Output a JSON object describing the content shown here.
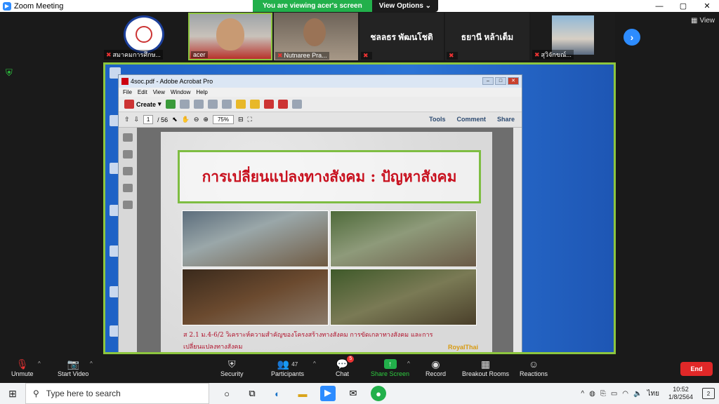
{
  "window": {
    "title": "Zoom Meeting",
    "controls": [
      "—",
      "▢",
      "✕"
    ]
  },
  "share_banner": {
    "viewing": "You are viewing acer's screen",
    "view_options": "View Options ⌄"
  },
  "participants_strip": [
    {
      "name": "สมาคมการศึกษ...",
      "muted": true,
      "kind": "logo"
    },
    {
      "name": "acer",
      "muted": false,
      "kind": "video"
    },
    {
      "name": "Nutnaree Pra...",
      "muted": true,
      "kind": "video"
    },
    {
      "name": "ชลลธร พัฒนโชติ",
      "muted": true,
      "kind": "name"
    },
    {
      "name": "ธยานี หล้าเต็ม",
      "muted": true,
      "kind": "name"
    },
    {
      "name": "สุวิจักขณ์...",
      "muted": true,
      "kind": "video"
    }
  ],
  "view_label": "View",
  "acrobat": {
    "title": "4soc.pdf - Adobe Acrobat Pro",
    "menu": [
      "File",
      "Edit",
      "View",
      "Window",
      "Help"
    ],
    "create_label": "Create",
    "page_current": "1",
    "page_total": "/ 56",
    "zoom": "75%",
    "right_tools": [
      "Tools",
      "Comment",
      "Share"
    ]
  },
  "slide": {
    "title": "การเปลี่ยนแปลงทางสังคม : ปัญหาสังคม",
    "caption_line1": "ส 2.1  ม.4-6/2  วิเคราะห์ความสำคัญของโครงสร้างทางสังคม การขัดเกลาทางสังคม และการ",
    "caption_line2": "เปลี่ยนแปลงทางสังคม",
    "brand": "RoyalThai"
  },
  "toolbar": {
    "unmute": "Unmute",
    "start_video": "Start Video",
    "security": "Security",
    "participants": "Participants",
    "participants_count": "47",
    "chat": "Chat",
    "chat_badge": "5",
    "share_screen": "Share Screen",
    "record": "Record",
    "breakout": "Breakout Rooms",
    "reactions": "Reactions",
    "end": "End"
  },
  "taskbar": {
    "search_placeholder": "Type here to search",
    "time": "10:52",
    "date": "1/8/2564",
    "lang": "ไทย",
    "notifications": "2"
  },
  "colors": {
    "zoom_blue": "#2d8cff",
    "share_green": "#22b04b",
    "end_red": "#e02828",
    "slide_title_red": "#c8101e"
  }
}
